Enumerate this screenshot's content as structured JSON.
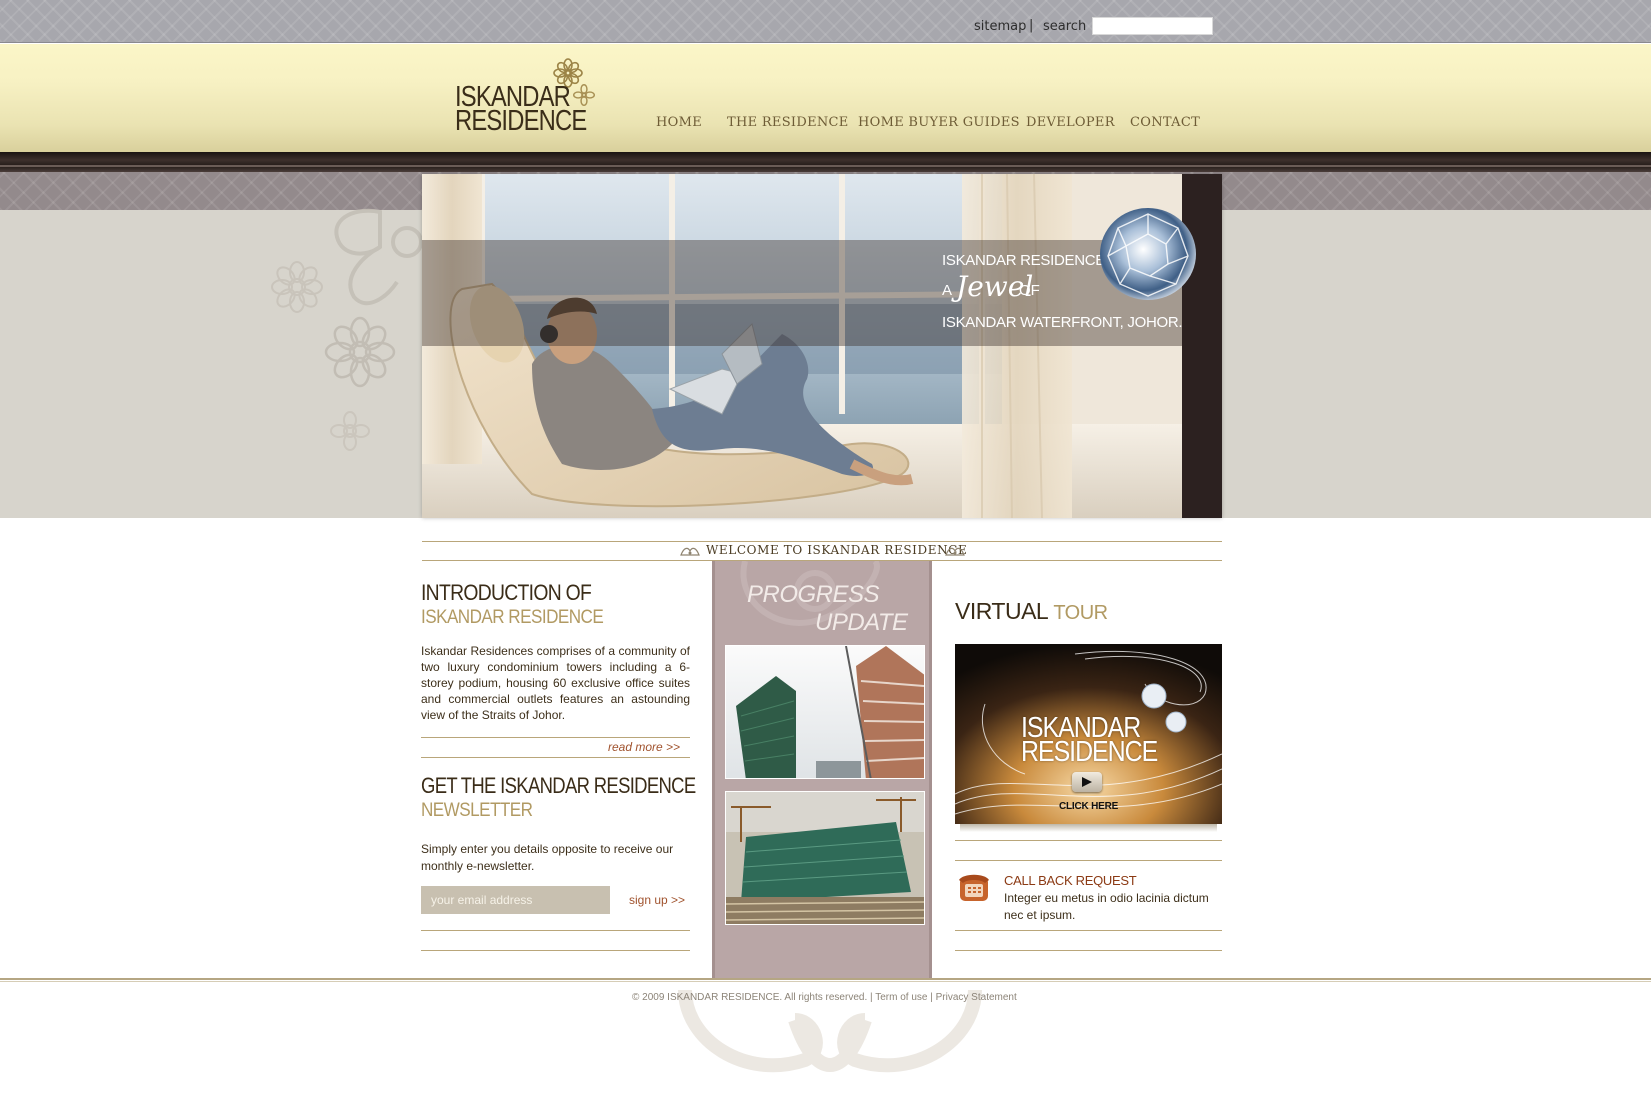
{
  "topbar": {
    "sitemap_label": "sitemap",
    "separator": "|",
    "search_label": "search",
    "search_value": ""
  },
  "logo": {
    "line1": "ISKANDAR",
    "line2": "RESIDENCE"
  },
  "nav": {
    "items": [
      {
        "label": "HOME"
      },
      {
        "label": "THE RESIDENCE"
      },
      {
        "label": "HOME BUYER GUIDES"
      },
      {
        "label": "DEVELOPER"
      },
      {
        "label": "CONTACT"
      }
    ]
  },
  "hero": {
    "line1": "ISKANDAR RESIDENCE",
    "line2_a": "A",
    "line2_jewel": "Jewel",
    "line2_of": "OF",
    "line3": "ISKANDAR WATERFRONT, JOHOR."
  },
  "welcome": {
    "title": "WELCOME TO ISKANDAR RESIDENCE"
  },
  "intro": {
    "title_line1": "INTRODUCTION OF",
    "title_line2": "ISKANDAR RESIDENCE",
    "body": "Iskandar Residences comprises of a community of two luxury condominium towers including a 6-storey podium, housing 60 exclusive office suites and commercial outlets features an astounding view of the Straits of Johor.",
    "read_more": "read more >>"
  },
  "newsletter": {
    "title_line1": "GET THE ISKANDAR RESIDENCE",
    "title_line2": "NEWSLETTER",
    "body": "Simply enter you details opposite to receive our monthly e-newsletter.",
    "email_placeholder": "your email address",
    "signup_label": "sign up >>"
  },
  "progress": {
    "title_line1": "PROGRESS",
    "title_line2": "UPDATE"
  },
  "virtual_tour": {
    "title_word1": "VIRTUAL",
    "title_word2": "TOUR",
    "video_line1": "ISKANDAR",
    "video_line2": "RESIDENCE",
    "click_label": "CLICK HERE"
  },
  "callback": {
    "title": "CALL BACK REQUEST",
    "body": "Integer eu metus in odio lacinia dictum nec et ipsum."
  },
  "footer": {
    "copyright": "© 2009 ISKANDAR RESIDENCE. All rights reserved.",
    "sep1": " | ",
    "terms": "Term of use",
    "sep2": " | ",
    "privacy": "Privacy Statement"
  },
  "colors": {
    "accent_gold": "#b19a63",
    "dark_brown": "#3a2c18",
    "link_rust": "#a0522d",
    "progress_mauve": "#b9a6a6",
    "header_cream": "#f7f1c3"
  },
  "icons": [
    "flower-logo-icon",
    "flower-ornament-icon",
    "diamond-icon",
    "play-icon",
    "phone-icon"
  ]
}
